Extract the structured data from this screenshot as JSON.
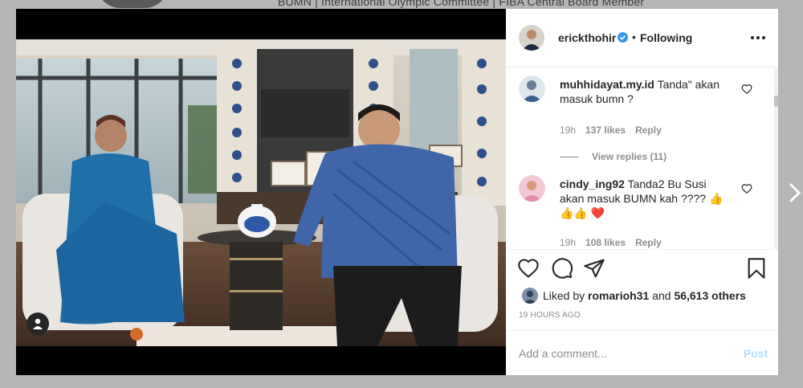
{
  "background": {
    "bio_text": "BUMN | International Olympic Committee | FIBA Central Board Member"
  },
  "post": {
    "username": "erickthohir",
    "separator": "•",
    "follow_status": "Following",
    "verified": true,
    "comments": [
      {
        "username": "muhhidayat.my.id",
        "text": "Tanda\" akan masuk bumn ?",
        "time": "19h",
        "likes": "137 likes",
        "reply_label": "Reply",
        "view_replies": "View replies (11)"
      },
      {
        "username": "cindy_ing92",
        "text": "Tanda2 Bu Susi akan masuk BUMN kah ???? 👍👍👍 ❤️",
        "time": "19h",
        "likes": "108 likes",
        "reply_label": "Reply"
      }
    ],
    "liked_by_prefix": "Liked by",
    "liked_by_user": "romarioh31",
    "liked_by_and": "and",
    "liked_by_others": "56,613 others",
    "timestamp": "19 HOURS AGO",
    "comment_placeholder": "Add a comment...",
    "post_label": "Post"
  },
  "colors": {
    "verified": "#3897f0",
    "text": "#262626",
    "muted": "#8e8e8e",
    "post_disabled": "#b2dffc"
  }
}
